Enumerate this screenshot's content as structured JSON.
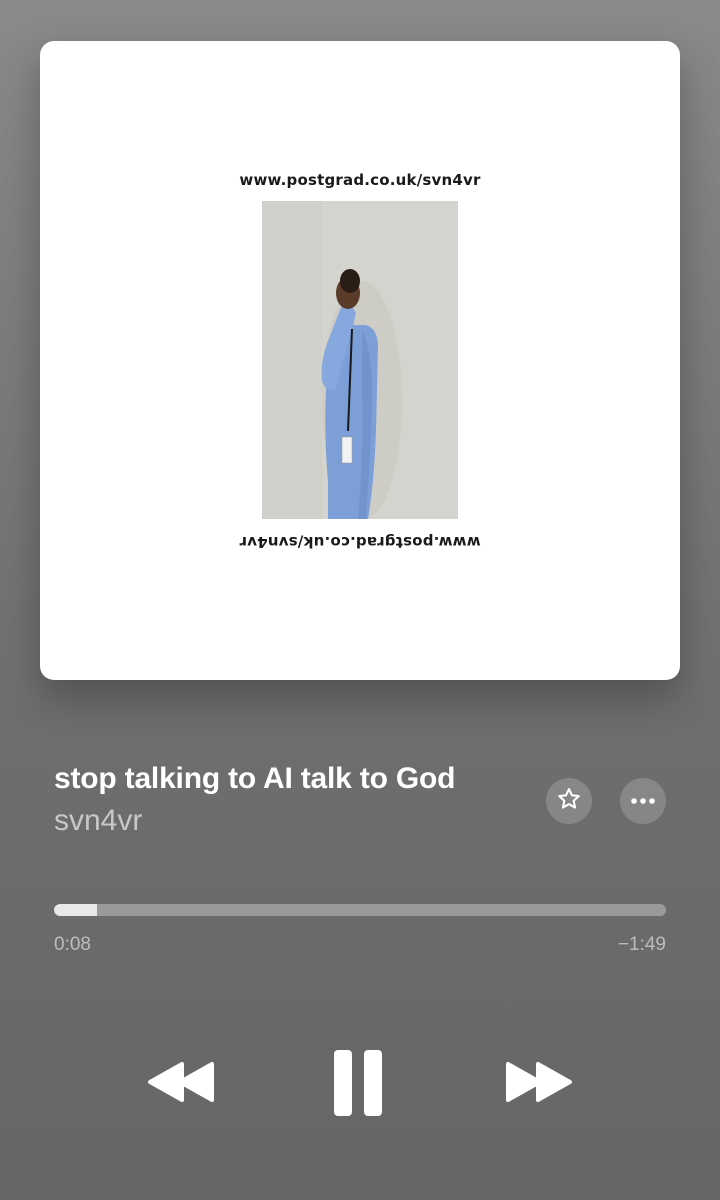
{
  "artwork": {
    "url_top": "www.postgrad.co.uk/svn4vr",
    "url_bottom": "www.postgrad.co.uk/svn4vr"
  },
  "track": {
    "title": "stop talking to AI talk to God",
    "artist": "svn4vr"
  },
  "progress": {
    "elapsed": "0:08",
    "remaining": "−1:49",
    "fraction": 0.07
  },
  "icons": {
    "favorite": "star-icon",
    "more": "ellipsis-icon",
    "rewind": "rewind-icon",
    "pause": "pause-icon",
    "forward": "fast-forward-icon"
  },
  "colors": {
    "background": "#7b7b7b",
    "foreground": "#ffffff"
  }
}
